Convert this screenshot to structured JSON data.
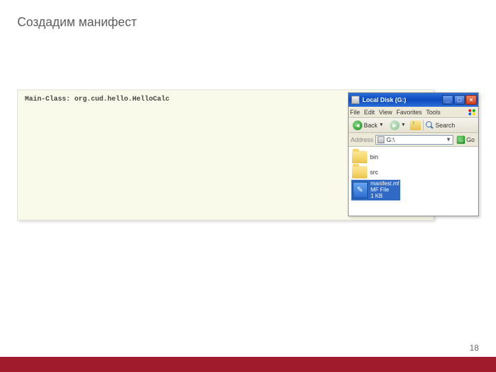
{
  "slide": {
    "title": "Создадим манифест",
    "page_number": "18"
  },
  "code": {
    "line1": "Main-Class: org.cud.hello.HelloCalc"
  },
  "explorer": {
    "title": "Local Disk (G:)",
    "menu": {
      "file": "File",
      "edit": "Edit",
      "view": "View",
      "favorites": "Favorites",
      "tools": "Tools"
    },
    "toolbar": {
      "back": "Back",
      "search": "Search"
    },
    "address": {
      "label": "Address",
      "path": "G:\\",
      "go": "Go"
    },
    "items": {
      "folder1": "bin",
      "folder2": "src",
      "manifest": {
        "name": "manifest.mf",
        "type": "MF File",
        "size": "1 KB"
      }
    }
  }
}
